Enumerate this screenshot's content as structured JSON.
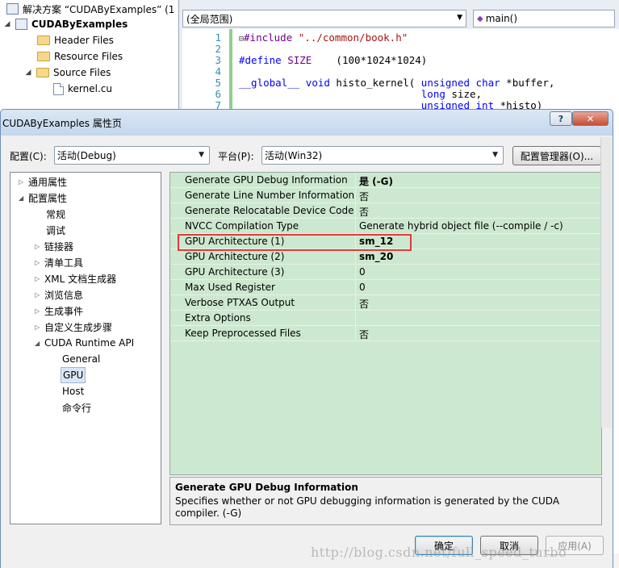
{
  "solution_explorer": {
    "solution_label": "解决方案 “CUDAByExamples” (1",
    "project_label": "CUDAByExamples",
    "items": [
      {
        "label": "Header Files"
      },
      {
        "label": "Resource Files"
      },
      {
        "label": "Source Files"
      },
      {
        "label": "kernel.cu"
      }
    ]
  },
  "editor": {
    "scope_combo": "(全局范围)",
    "member_combo": "main()",
    "lines": [
      {
        "num": "1",
        "text": "#include \"../common/book.h\""
      },
      {
        "num": "2",
        "text": ""
      },
      {
        "num": "3",
        "text": "#define SIZE    (100*1024*1024)"
      },
      {
        "num": "4",
        "text": ""
      },
      {
        "num": "5",
        "text": "__global__ void histo_kernel( unsigned char *buffer,"
      },
      {
        "num": "6",
        "text": "                              long size,"
      },
      {
        "num": "7",
        "text": "                              unsigned int *histo)"
      }
    ]
  },
  "dialog": {
    "title": "CUDAByExamples 属性页",
    "help_label": "?",
    "close_label": "✕",
    "config_label": "配置(C):",
    "config_value": "活动(Debug)",
    "platform_label": "平台(P):",
    "platform_value": "活动(Win32)",
    "config_manager_label": "配置管理器(O)...",
    "tree": [
      {
        "label": "通用属性",
        "expander": "▷"
      },
      {
        "label": "配置属性",
        "expander": "◢"
      },
      {
        "label": "常规",
        "expander": ""
      },
      {
        "label": "调试",
        "expander": ""
      },
      {
        "label": "链接器",
        "expander": "▷"
      },
      {
        "label": "清单工具",
        "expander": "▷"
      },
      {
        "label": "XML 文档生成器",
        "expander": "▷"
      },
      {
        "label": "浏览信息",
        "expander": "▷"
      },
      {
        "label": "生成事件",
        "expander": "▷"
      },
      {
        "label": "自定义生成步骤",
        "expander": "▷"
      },
      {
        "label": "CUDA Runtime API",
        "expander": "◢"
      },
      {
        "label": "General",
        "expander": ""
      },
      {
        "label": "GPU",
        "expander": ""
      },
      {
        "label": "Host",
        "expander": ""
      },
      {
        "label": "命令行",
        "expander": ""
      }
    ],
    "properties": [
      {
        "name": "Generate GPU Debug Information",
        "value": "是 (-G)"
      },
      {
        "name": "Generate Line Number Information",
        "value": "否"
      },
      {
        "name": "Generate Relocatable Device Code",
        "value": "否"
      },
      {
        "name": "NVCC Compilation Type",
        "value": "Generate hybrid object file  (--compile / -c)"
      },
      {
        "name": "GPU Architecture (1)",
        "value": "sm_12"
      },
      {
        "name": "GPU Architecture (2)",
        "value": "sm_20"
      },
      {
        "name": "GPU Architecture (3)",
        "value": "0"
      },
      {
        "name": "Max Used Register",
        "value": "0"
      },
      {
        "name": "Verbose PTXAS Output",
        "value": "否"
      },
      {
        "name": "Extra Options",
        "value": ""
      },
      {
        "name": "Keep Preprocessed Files",
        "value": "否"
      }
    ],
    "description_title": "Generate GPU Debug Information",
    "description_text": "Specifies whether or not GPU debugging information is generated by the CUDA compiler. (-G)",
    "ok_label": "确定",
    "cancel_label": "取消",
    "apply_label": "应用(A)"
  },
  "watermark": "http://blog.csdn.net/full_speed_turbo",
  "colors": {
    "grid_bg": "#cde8d0",
    "highlight": "#e23a3a",
    "title_bg": "#c3d7ec"
  }
}
